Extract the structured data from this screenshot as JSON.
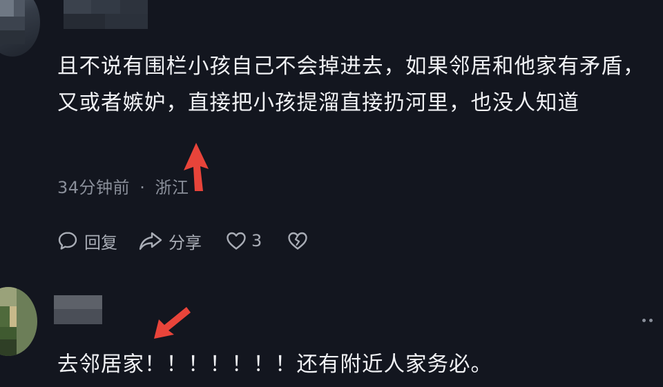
{
  "comments": [
    {
      "text": "且不说有围栏小孩自己不会掉进去，如果邻居和他家有矛盾，又或者嫉妒，直接把小孩提溜直接扔河里，也没人知道",
      "time": "34分钟前",
      "separator": "·",
      "location": "浙江",
      "actions": {
        "reply_label": "回复",
        "share_label": "分享",
        "like_count": "3"
      }
    },
    {
      "text": "去邻居家！！！！！！！还有附近人家务必。"
    }
  ],
  "colors": {
    "background": "#13161f",
    "text": "#f0f1f4",
    "meta": "#8a8f9a",
    "action": "#a9adb6",
    "annotation_arrow": "#e8443a"
  },
  "icons": {
    "reply": "speech-bubble-icon",
    "share": "share-arrow-icon",
    "like": "heart-icon",
    "dislike": "broken-heart-icon",
    "more": "more-dots-icon"
  }
}
